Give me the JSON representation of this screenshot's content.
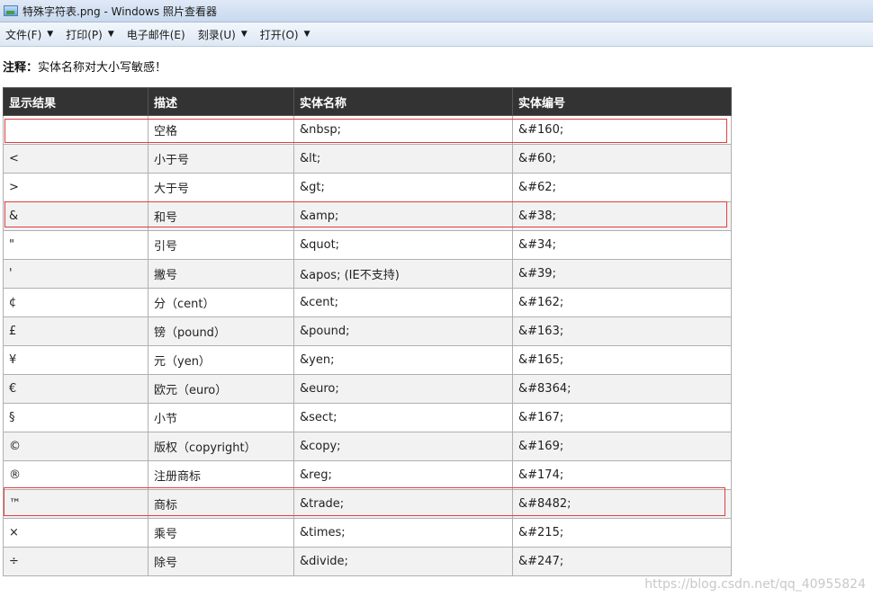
{
  "window": {
    "title": "特殊字符表.png - Windows 照片查看器",
    "icon": "photo-viewer-icon"
  },
  "menu": [
    {
      "label": "文件(F)",
      "has_arrow": true
    },
    {
      "label": "打印(P)",
      "has_arrow": true
    },
    {
      "label": "电子邮件(E)",
      "has_arrow": false
    },
    {
      "label": "刻录(U)",
      "has_arrow": true
    },
    {
      "label": "打开(O)",
      "has_arrow": true
    }
  ],
  "note": {
    "prefix": "注释：",
    "text": "实体名称对大小写敏感！"
  },
  "table": {
    "headers": [
      "显示结果",
      "描述",
      "实体名称",
      "实体编号"
    ],
    "rows": [
      {
        "display": "",
        "desc": "空格",
        "name": "&nbsp;",
        "number": "&#160;",
        "highlighted": true
      },
      {
        "display": "<",
        "desc": "小于号",
        "name": "&lt;",
        "number": "&#60;",
        "highlighted": false
      },
      {
        "display": ">",
        "desc": "大于号",
        "name": "&gt;",
        "number": "&#62;",
        "highlighted": false
      },
      {
        "display": "&",
        "desc": "和号",
        "name": "&amp;",
        "number": "&#38;",
        "highlighted": true
      },
      {
        "display": "\"",
        "desc": "引号",
        "name": "&quot;",
        "number": "&#34;",
        "highlighted": false
      },
      {
        "display": "'",
        "desc": "撇号",
        "name": "&apos; (IE不支持)",
        "number": "&#39;",
        "highlighted": false
      },
      {
        "display": "¢",
        "desc": "分（cent）",
        "name": "&cent;",
        "number": "&#162;",
        "highlighted": false
      },
      {
        "display": "£",
        "desc": "镑（pound）",
        "name": "&pound;",
        "number": "&#163;",
        "highlighted": false
      },
      {
        "display": "¥",
        "desc": "元（yen）",
        "name": "&yen;",
        "number": "&#165;",
        "highlighted": false
      },
      {
        "display": "€",
        "desc": "欧元（euro）",
        "name": "&euro;",
        "number": "&#8364;",
        "highlighted": false
      },
      {
        "display": "§",
        "desc": "小节",
        "name": "&sect;",
        "number": "&#167;",
        "highlighted": false
      },
      {
        "display": "©",
        "desc": "版权（copyright）",
        "name": "&copy;",
        "number": "&#169;",
        "highlighted": false
      },
      {
        "display": "®",
        "desc": "注册商标",
        "name": "&reg;",
        "number": "&#174;",
        "highlighted": false
      },
      {
        "display": "™",
        "desc": "商标",
        "name": "&trade;",
        "number": "&#8482;",
        "highlighted": true
      },
      {
        "display": "×",
        "desc": "乘号",
        "name": "&times;",
        "number": "&#215;",
        "highlighted": false
      },
      {
        "display": "÷",
        "desc": "除号",
        "name": "&divide;",
        "number": "&#247;",
        "highlighted": false
      }
    ]
  },
  "watermark": "https://blog.csdn.net/qq_40955824",
  "colors": {
    "header_bg": "#333333",
    "highlight_border": "#e04040",
    "alt_row_bg": "#f2f2f2"
  }
}
